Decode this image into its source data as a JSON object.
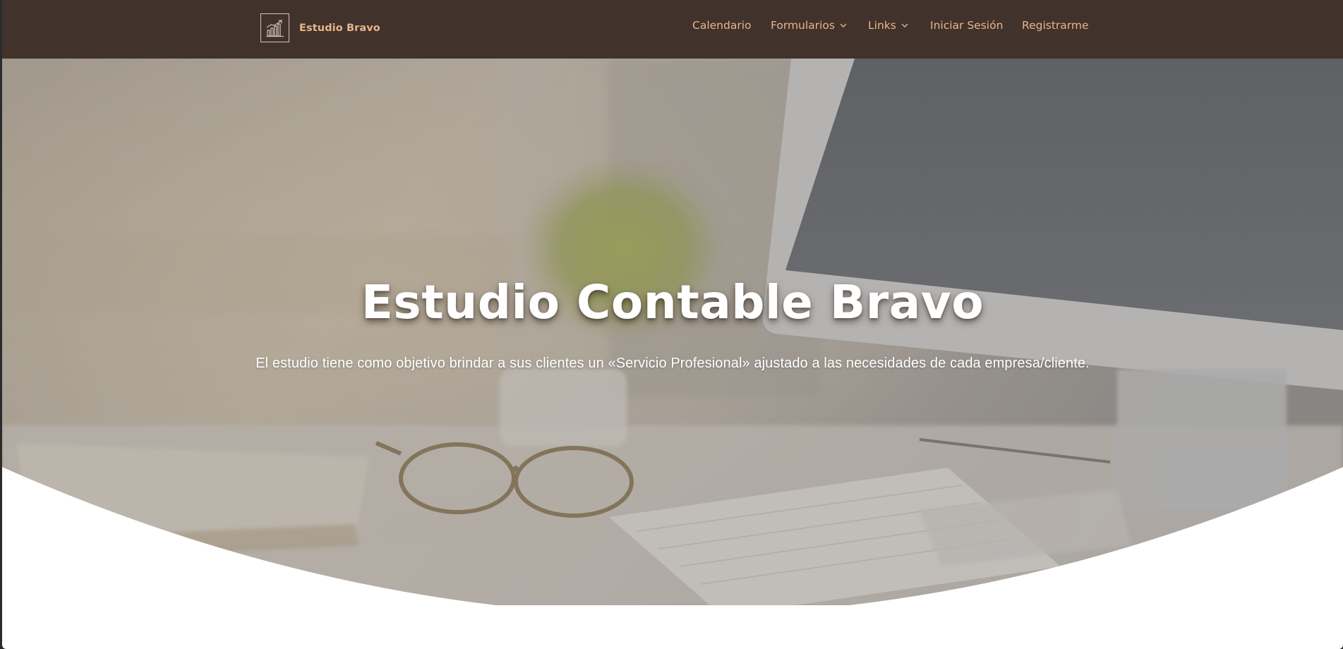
{
  "brand": {
    "name": "Estudio Bravo",
    "logo_icon": "bar-chart-growth-icon"
  },
  "nav": {
    "items": [
      {
        "label": "Calendario",
        "has_dropdown": false
      },
      {
        "label": "Formularios",
        "has_dropdown": true
      },
      {
        "label": "Links",
        "has_dropdown": true
      },
      {
        "label": "Iniciar Sesión",
        "has_dropdown": false
      },
      {
        "label": "Registrarme",
        "has_dropdown": false
      }
    ]
  },
  "hero": {
    "title": "Estudio Contable Bravo",
    "subtitle": "El estudio tiene como objetivo brindar a sus clientes un «Servicio Profesional» ajustado a las necesidades de cada empresa/cliente.",
    "background": "desk-with-plant-glasses-keyboard-monitor-photo"
  },
  "colors": {
    "header_bg": "#41322b",
    "accent": "#e7b58a",
    "overlay": "#8c8580",
    "page_bg": "#ffffff"
  }
}
